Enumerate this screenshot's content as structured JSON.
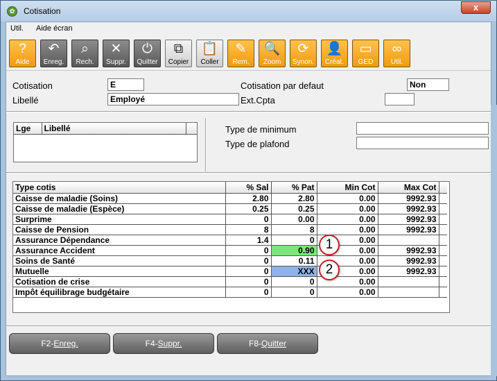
{
  "window": {
    "title": "Cotisation",
    "close": "x"
  },
  "menu": [
    "Util.",
    "Aide écran"
  ],
  "toolbar": [
    {
      "label": "Aide",
      "icon": "help-icon",
      "glyph": "?",
      "style": "orange"
    },
    {
      "label": "Enreg.",
      "icon": "undo-arrow-icon",
      "glyph": "↶",
      "style": "gray"
    },
    {
      "label": "Rech.",
      "icon": "binoculars-search-icon",
      "glyph": "⌕",
      "style": "gray"
    },
    {
      "label": "Suppr.",
      "icon": "delete-cross-icon",
      "glyph": "✕",
      "style": "gray"
    },
    {
      "label": "Quitter",
      "icon": "power-icon",
      "glyph": "⏻",
      "style": "gray"
    },
    {
      "label": "Copier",
      "icon": "copy-icon",
      "glyph": "⧉",
      "style": "light"
    },
    {
      "label": "Coller",
      "icon": "paste-clipboard-icon",
      "glyph": "📋",
      "style": "light"
    },
    {
      "label": "Rem.",
      "icon": "pencil-icon",
      "glyph": "✎",
      "style": "orange"
    },
    {
      "label": "Zoom",
      "icon": "magnifier-icon",
      "glyph": "🔍",
      "style": "orange"
    },
    {
      "label": "Synon.",
      "icon": "sync-arrows-icon",
      "glyph": "⟳",
      "style": "orange"
    },
    {
      "label": "Créat.",
      "icon": "user-create-icon",
      "glyph": "👤",
      "style": "orange"
    },
    {
      "label": "GED",
      "icon": "folder-icon",
      "glyph": "▭",
      "style": "orange"
    },
    {
      "label": "Util.",
      "icon": "chain-links-icon",
      "glyph": "∞",
      "style": "orange"
    }
  ],
  "form": {
    "cotisation_label": "Cotisation",
    "cotisation_value": "E",
    "libelle_label": "Libellé",
    "libelle_value": "Employé",
    "defaut_label": "Cotisation par defaut",
    "defaut_value": "Non",
    "extcpta_label": "Ext.Cpta",
    "extcpta_value": ""
  },
  "lge_table": {
    "headers": [
      "Lge",
      "Libellé"
    ]
  },
  "types": {
    "minimum_label": "Type de minimum",
    "minimum_value": "",
    "plafond_label": "Type de plafond",
    "plafond_value": ""
  },
  "grid": {
    "headers": [
      "Type cotis",
      "% Sal",
      "% Pat",
      "Min Cot",
      "Max Cot"
    ],
    "rows": [
      [
        "Caisse de maladie (Soins)",
        "2.80",
        "2.80",
        "0.00",
        "9992.93"
      ],
      [
        "Caisse de maladie (Espèce)",
        "0.25",
        "0.25",
        "0.00",
        "9992.93"
      ],
      [
        "Surprime",
        "0",
        "0.00",
        "0.00",
        "9992.93"
      ],
      [
        "Caisse de Pension",
        "8",
        "8",
        "0.00",
        "9992.93"
      ],
      [
        "Assurance Dépendance",
        "1.4",
        "0",
        "0.00",
        ""
      ],
      [
        "Assurance Accident",
        "0",
        "0.90",
        "0.00",
        "9992.93"
      ],
      [
        "Soins de Santé",
        "0",
        "0.11",
        "0.00",
        "9992.93"
      ],
      [
        "Mutuelle",
        "0",
        "XXX",
        "0.00",
        "9992.93"
      ],
      [
        "Cotisation de crise",
        "0",
        "0",
        "0.00",
        ""
      ],
      [
        "Impôt équilibrage budgétaire",
        "0",
        "0",
        "0.00",
        ""
      ]
    ],
    "highlight_green_row": 5,
    "highlight_blue_row": 7
  },
  "badges": [
    "1",
    "2"
  ],
  "footer": [
    {
      "key": "F2-",
      "label": "Enreg."
    },
    {
      "key": "F4-",
      "label": "Suppr."
    },
    {
      "key": "F8-",
      "label": "Quitter"
    }
  ],
  "colors": {
    "accent": "#f19a12",
    "highlight_green": "#7ee57e",
    "highlight_blue": "#8fb2e8",
    "badge_border": "#c32020"
  }
}
